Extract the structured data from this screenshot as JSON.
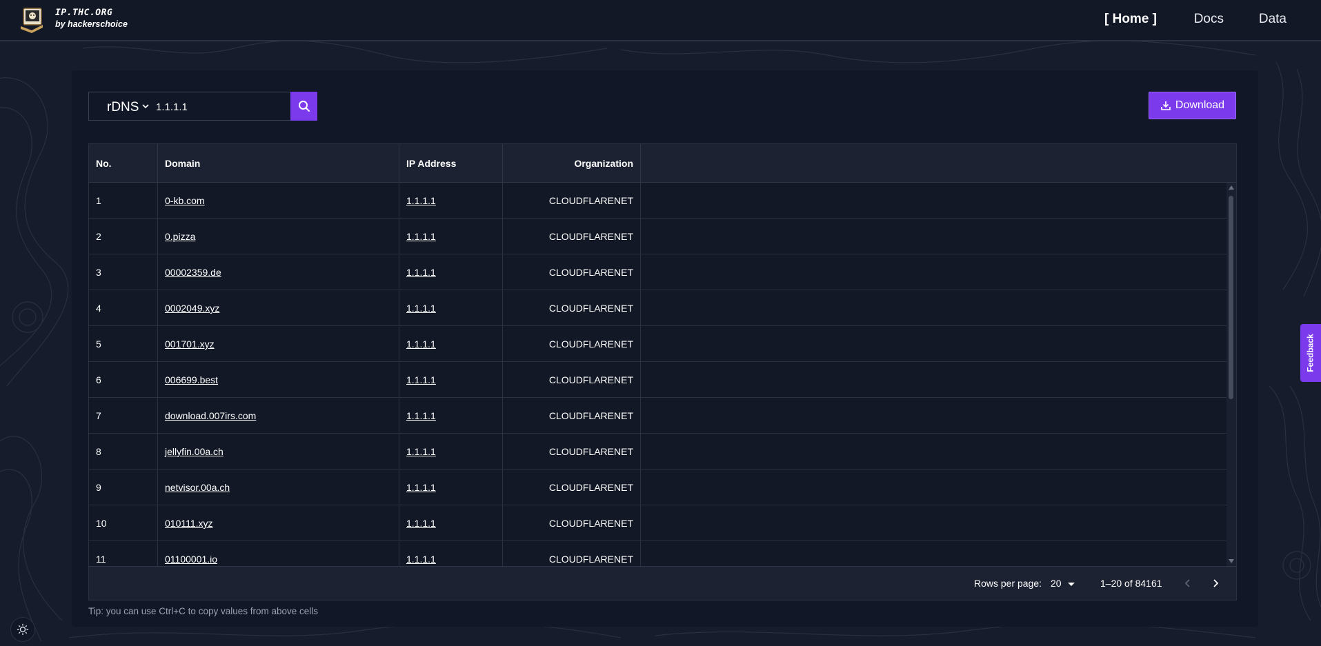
{
  "header": {
    "brand_title": "IP.THC.ORG",
    "brand_sub": "by hackerschoice",
    "nav": [
      {
        "label": "[ Home ]"
      },
      {
        "label": "Docs"
      },
      {
        "label": "Data"
      }
    ]
  },
  "search": {
    "type": "rDNS",
    "value": "1.1.1.1"
  },
  "toolbar": {
    "download_label": "Download"
  },
  "table": {
    "columns": [
      "No.",
      "Domain",
      "IP Address",
      "Organization"
    ],
    "rows": [
      {
        "no": "1",
        "domain": "0-kb.com",
        "ip": "1.1.1.1",
        "org": "CLOUDFLARENET"
      },
      {
        "no": "2",
        "domain": "0.pizza",
        "ip": "1.1.1.1",
        "org": "CLOUDFLARENET"
      },
      {
        "no": "3",
        "domain": "00002359.de",
        "ip": "1.1.1.1",
        "org": "CLOUDFLARENET"
      },
      {
        "no": "4",
        "domain": "0002049.xyz",
        "ip": "1.1.1.1",
        "org": "CLOUDFLARENET"
      },
      {
        "no": "5",
        "domain": "001701.xyz",
        "ip": "1.1.1.1",
        "org": "CLOUDFLARENET"
      },
      {
        "no": "6",
        "domain": "006699.best",
        "ip": "1.1.1.1",
        "org": "CLOUDFLARENET"
      },
      {
        "no": "7",
        "domain": "download.007irs.com",
        "ip": "1.1.1.1",
        "org": "CLOUDFLARENET"
      },
      {
        "no": "8",
        "domain": "jellyfin.00a.ch",
        "ip": "1.1.1.1",
        "org": "CLOUDFLARENET"
      },
      {
        "no": "9",
        "domain": "netvisor.00a.ch",
        "ip": "1.1.1.1",
        "org": "CLOUDFLARENET"
      },
      {
        "no": "10",
        "domain": "010111.xyz",
        "ip": "1.1.1.1",
        "org": "CLOUDFLARENET"
      },
      {
        "no": "11",
        "domain": "01100001.io",
        "ip": "1.1.1.1",
        "org": "CLOUDFLARENET"
      }
    ]
  },
  "pagination": {
    "rows_per_page_label": "Rows per page:",
    "rows_per_page": "20",
    "range": "1–20 of 84161"
  },
  "tip": "Tip: you can use Ctrl+C to copy values from above cells",
  "feedback_label": "Feedback",
  "colors": {
    "accent": "#7c3aed",
    "background": "#161c2b",
    "panel": "#111727"
  }
}
